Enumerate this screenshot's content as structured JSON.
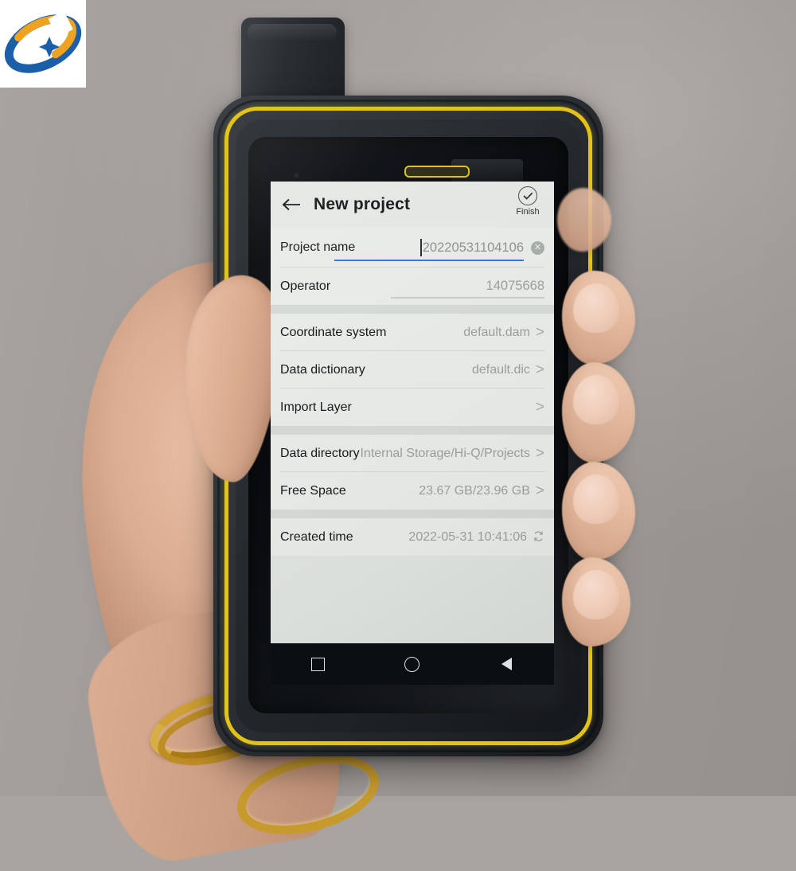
{
  "photo": {
    "scene": "hand-holding-rugged-android-handheld",
    "background_color": "#a9a4a0",
    "device_body_color": "#262a2e",
    "device_trim_color": "#e3c318",
    "skin_color": "#dcae93",
    "bracelet_color": "#c7952a"
  },
  "logo": {
    "name": "brand-logo",
    "background": "#ffffff",
    "ring_color": "#1d5ea8",
    "arc_color": "#eda320",
    "star_color": "#1d5ea8"
  },
  "app": {
    "appbar": {
      "back_icon": "back-arrow-icon",
      "title": "New project",
      "finish_icon": "check-circle-icon",
      "finish_label": "Finish"
    },
    "accent_color": "#2c7fd4",
    "groups": [
      {
        "rows": [
          {
            "type": "input",
            "name": "project-name",
            "label": "Project name",
            "value": "20220531104106",
            "focused": true,
            "clear_icon": "clear-circle-icon"
          },
          {
            "type": "input",
            "name": "operator",
            "label": "Operator",
            "value": "14075668",
            "focused": false
          }
        ]
      },
      {
        "rows": [
          {
            "type": "nav",
            "name": "coordinate-system",
            "label": "Coordinate system",
            "value": "default.dam",
            "chevron": ">"
          },
          {
            "type": "nav",
            "name": "data-dictionary",
            "label": "Data dictionary",
            "value": "default.dic",
            "chevron": ">"
          },
          {
            "type": "nav",
            "name": "import-layer",
            "label": "Import Layer",
            "value": "",
            "chevron": ">"
          }
        ]
      },
      {
        "rows": [
          {
            "type": "nav",
            "name": "data-directory",
            "label": "Data directory",
            "value": "Internal Storage/Hi-Q/Projects",
            "chevron": ">"
          },
          {
            "type": "nav",
            "name": "free-space",
            "label": "Free Space",
            "value": "23.67 GB/23.96 GB",
            "chevron": ">"
          }
        ]
      },
      {
        "rows": [
          {
            "type": "refresh",
            "name": "created-time",
            "label": "Created time",
            "value": "2022-05-31 10:41:06",
            "refresh_icon": "refresh-icon"
          }
        ]
      }
    ]
  },
  "navbar": {
    "recents_icon": "square-recents-icon",
    "home_icon": "circle-home-icon",
    "back_icon": "triangle-back-icon"
  }
}
